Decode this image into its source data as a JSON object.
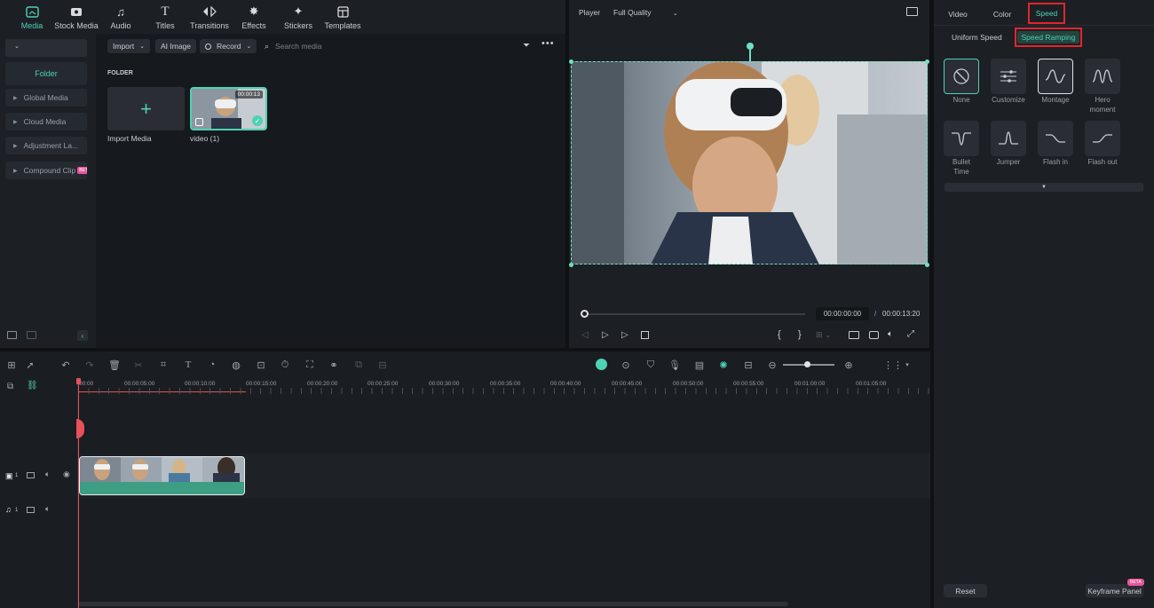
{
  "topnav": {
    "items": [
      {
        "label": "Media",
        "icon": "media-icon",
        "active": true
      },
      {
        "label": "Stock Media",
        "icon": "stock-media-icon"
      },
      {
        "label": "Audio",
        "icon": "audio-icon"
      },
      {
        "label": "Titles",
        "icon": "titles-icon"
      },
      {
        "label": "Transitions",
        "icon": "transitions-icon"
      },
      {
        "label": "Effects",
        "icon": "effects-icon"
      },
      {
        "label": "Stickers",
        "icon": "stickers-icon"
      },
      {
        "label": "Templates",
        "icon": "templates-icon"
      }
    ]
  },
  "sidebar": {
    "folder_label": "Folder",
    "items": [
      {
        "label": "Global Media"
      },
      {
        "label": "Cloud Media"
      },
      {
        "label": "Adjustment La..."
      },
      {
        "label": "Compound Clip",
        "badge": "BETA"
      }
    ]
  },
  "media": {
    "import_label": "Import",
    "ai_image_label": "AI Image",
    "record_label": "Record",
    "search_placeholder": "Search media",
    "folder_heading": "FOLDER",
    "import_tile_label": "Import Media",
    "video_tile_label": "video (1)",
    "video_duration": "00:00:13"
  },
  "player": {
    "label": "Player",
    "quality": "Full Quality",
    "current_time": "00:00:00:00",
    "separator": "/",
    "total_time": "00:00:13:20"
  },
  "props": {
    "tabs": [
      "Video",
      "Color",
      "Speed"
    ],
    "active_tab": "Speed",
    "subtabs": [
      "Uniform Speed",
      "Speed Ramping"
    ],
    "active_subtab": "Speed Ramping",
    "presets": [
      {
        "label": "None",
        "icon": "none-icon"
      },
      {
        "label": "Customize",
        "icon": "customize-icon"
      },
      {
        "label": "Montage",
        "icon": "montage-curve-icon"
      },
      {
        "label": "Hero\nmoment",
        "icon": "hero-moment-curve-icon"
      },
      {
        "label": "Bullet\nTime",
        "icon": "bullet-time-curve-icon"
      },
      {
        "label": "Jumper",
        "icon": "jumper-curve-icon"
      },
      {
        "label": "Flash in",
        "icon": "flash-in-curve-icon"
      },
      {
        "label": "Flash out",
        "icon": "flash-out-curve-icon"
      }
    ],
    "reset_label": "Reset",
    "keyframe_label": "Keyframe Panel",
    "keyframe_badge": "BETA"
  },
  "timeline": {
    "ruler_labels": [
      "00:00",
      "00:00:05:00",
      "00:00:10:00",
      "00:00:15:00",
      "00:00:20:00",
      "00:00:25:00",
      "00:00:30:00",
      "00:00:35:00",
      "00:00:40:00",
      "00:00:45:00",
      "00:00:50:00",
      "00:00:55:00",
      "00:01:00:00",
      "00:01:05:00"
    ],
    "video_track_num": "1",
    "audio_track_num": "1"
  },
  "colors": {
    "accent": "#4fd1b4",
    "highlight_box": "#e0262c",
    "playhead": "#e8505b"
  }
}
